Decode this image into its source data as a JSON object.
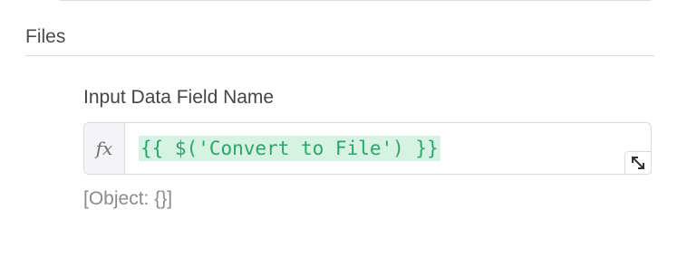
{
  "section": {
    "title": "Files"
  },
  "field": {
    "label": "Input Data Field Name",
    "fx_label": "fx",
    "expression": "{{ $('Convert to File') }}",
    "result": "[Object: {}]"
  },
  "colors": {
    "expression_text": "#2ea46a",
    "expression_highlight": "#d6f2e2",
    "divider": "#d9d7e8"
  },
  "icons": {
    "expand": "expand-diagonal-icon"
  }
}
